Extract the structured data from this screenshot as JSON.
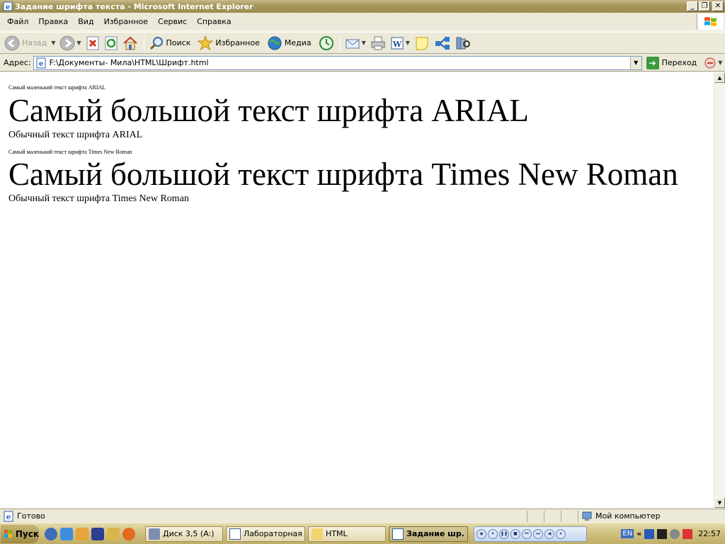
{
  "window": {
    "title": "Задание шрифта текста - Microsoft Internet Explorer",
    "minimize": "_",
    "restore": "❐",
    "close": "✕"
  },
  "menu": {
    "items": [
      {
        "label": "Файл"
      },
      {
        "label": "Правка"
      },
      {
        "label": "Вид"
      },
      {
        "label": "Избранное"
      },
      {
        "label": "Сервис"
      },
      {
        "label": "Справка"
      }
    ]
  },
  "toolbar": {
    "back": "Назад",
    "search": "Поиск",
    "favorites": "Избранное",
    "media": "Медиа"
  },
  "address": {
    "label": "Адрес:",
    "url": "F:\\Документы- Мила\\HTML\\Шрифт.html",
    "go": "Переход"
  },
  "content": {
    "lines": [
      {
        "text": "Самый маленький текст шрифта ARIAL"
      },
      {
        "text": "Самый большой текст шрифта ARIAL"
      },
      {
        "text": "Обычный текст шрифта ARIAL"
      },
      {
        "text": "Самый маленький текст шрифта Times New Roman"
      },
      {
        "text": "Самый большой текст шрифта Times New Roman"
      },
      {
        "text": "Обычный текст шрифта Times New Roman"
      }
    ]
  },
  "status": {
    "text": "Готово",
    "zone": "Мой компьютер"
  },
  "taskbar": {
    "start": "Пуск",
    "tasks": [
      {
        "label": "Диск 3,5 (A:)"
      },
      {
        "label": "Лабораторная ..."
      },
      {
        "label": "HTML"
      },
      {
        "label": "Задание шр..."
      }
    ],
    "lang": "EN",
    "chevron": "«",
    "clock": "22:57"
  },
  "colors": {
    "titlebar": "#A8985E",
    "chrome": "#ECE9D8",
    "content_bg": "#FFFFFF"
  },
  "icons": {
    "app": "ie-page-icon",
    "back": "back-arrow-icon",
    "forward": "forward-arrow-icon",
    "stop": "stop-icon",
    "refresh": "refresh-icon",
    "home": "home-icon",
    "search": "search-icon",
    "favorites": "star-icon",
    "media": "media-globe-icon",
    "history": "history-icon",
    "mail": "mail-icon",
    "print": "printer-icon",
    "edit": "word-icon",
    "discuss": "note-icon",
    "messenger": "messenger-icon",
    "research": "research-icon"
  }
}
